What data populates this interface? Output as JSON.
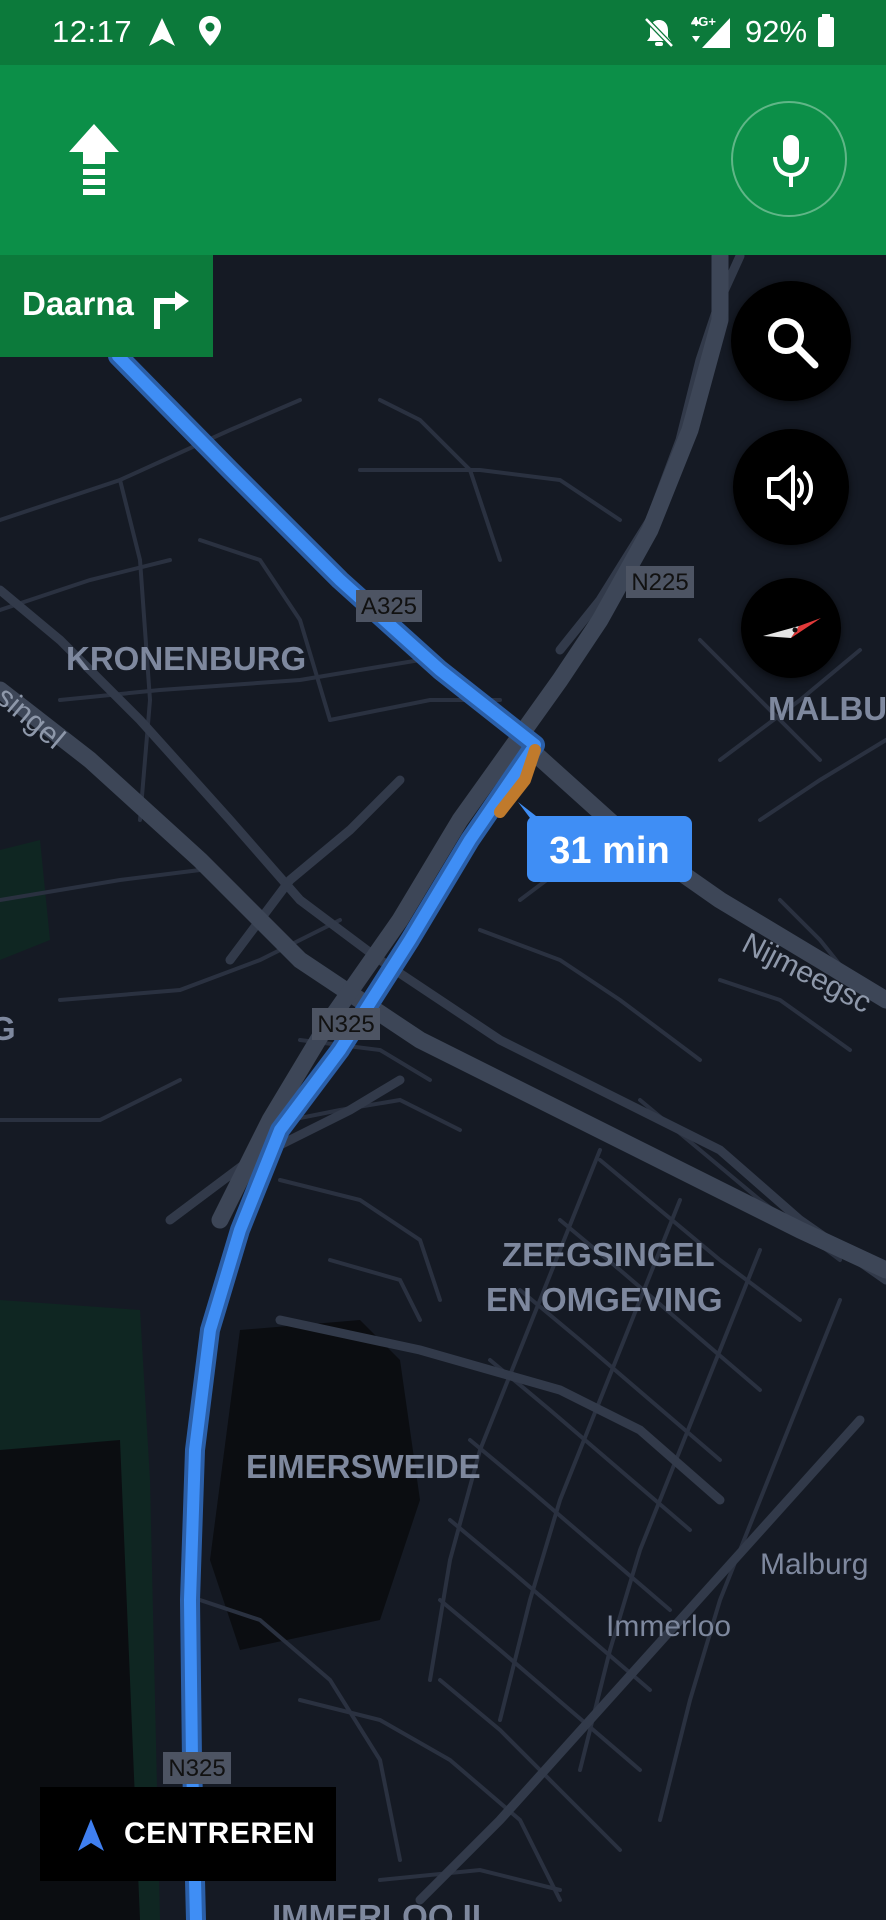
{
  "status_bar": {
    "time": "12:17",
    "network": "4G+",
    "battery": "92%"
  },
  "nav_header": {
    "direction_icon": "straight-arrow-icon",
    "voice_icon": "microphone-icon"
  },
  "next_turn": {
    "label": "Daarna",
    "icon": "turn-right-icon"
  },
  "map_controls": {
    "search_icon": "search-icon",
    "sound_icon": "speaker-icon",
    "compass_icon": "compass-icon"
  },
  "eta": {
    "label": "31 min"
  },
  "map_labels": {
    "kronenburg": "KRONENBURG",
    "malburgen_top": "MALBU",
    "zeegsingel_1": "ZEEGSINGEL",
    "zeegsingel_2": "EN OMGEVING",
    "eimersweide": "EIMERSWEIDE",
    "malburg": "Malburg",
    "immerloo": "Immerloo",
    "immerloo2": "IMMERLOO II",
    "nijmeegse": "Nijmeegsc",
    "singel": "singel",
    "g_fragment": "G"
  },
  "road_shields": {
    "a325": "A325",
    "n225": "N225",
    "n325_mid": "N325",
    "n325_bottom": "N325"
  },
  "centreren": {
    "label": "CENTREREN"
  },
  "colors": {
    "header_green": "#0c8f48",
    "status_green": "#0c7a3b",
    "route_blue": "#3f8ef5",
    "traffic_orange": "#c07a2c",
    "map_background": "#151a24"
  }
}
